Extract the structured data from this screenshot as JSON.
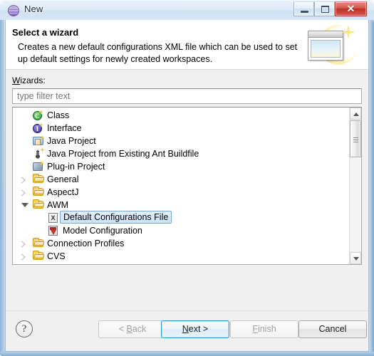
{
  "window": {
    "title": "New",
    "icon": "eclipse-sphere-icon",
    "controls": {
      "minimize": "minimize-icon",
      "maximize": "maximize-icon",
      "close": "✕"
    }
  },
  "banner": {
    "title": "Select a wizard",
    "description": "Creates a new default configurations XML file which can be used to set up default settings for newly created workspaces.",
    "art": "wizard-window-sparkle-graphic"
  },
  "form": {
    "wizards_label_prefix": "W",
    "wizards_label_rest": "izards:",
    "filter": {
      "placeholder": "type filter text",
      "value": ""
    }
  },
  "tree": {
    "rows": [
      {
        "label": "Class",
        "icon": "class-icon",
        "indent": 0,
        "twisty": "none",
        "selected": false
      },
      {
        "label": "Interface",
        "icon": "interface-icon",
        "indent": 0,
        "twisty": "none",
        "selected": false
      },
      {
        "label": "Java Project",
        "icon": "java-project-icon",
        "indent": 0,
        "twisty": "none",
        "selected": false
      },
      {
        "label": "Java Project from Existing Ant Buildfile",
        "icon": "ant-buildfile-icon",
        "indent": 0,
        "twisty": "none",
        "selected": false
      },
      {
        "label": "Plug-in Project",
        "icon": "plugin-project-icon",
        "indent": 0,
        "twisty": "none",
        "selected": false
      },
      {
        "label": "General",
        "icon": "folder-icon",
        "indent": 0,
        "twisty": "collapsed",
        "selected": false
      },
      {
        "label": "AspectJ",
        "icon": "folder-icon",
        "indent": 0,
        "twisty": "collapsed",
        "selected": false
      },
      {
        "label": "AWM",
        "icon": "folder-icon",
        "indent": 0,
        "twisty": "expanded",
        "selected": false
      },
      {
        "label": "Default Configurations File",
        "icon": "xml-file-icon",
        "indent": 1,
        "twisty": "none",
        "selected": true
      },
      {
        "label": "Model Configuration",
        "icon": "model-config-icon",
        "indent": 1,
        "twisty": "none",
        "selected": false
      },
      {
        "label": "Connection Profiles",
        "icon": "folder-icon",
        "indent": 0,
        "twisty": "collapsed",
        "selected": false
      },
      {
        "label": "CVS",
        "icon": "folder-icon",
        "indent": 0,
        "twisty": "collapsed",
        "selected": false
      }
    ],
    "scrollbar": {
      "up": "scroll-up-arrow-icon",
      "down": "scroll-down-arrow-icon"
    }
  },
  "buttons": {
    "help": "?",
    "back": {
      "prefix": "< ",
      "accel": "B",
      "rest": "ack",
      "state": "disabled"
    },
    "next": {
      "prefix": "",
      "accel": "N",
      "rest": "ext >",
      "state": "default"
    },
    "finish": {
      "prefix": "",
      "accel": "F",
      "rest": "inish",
      "state": "disabled"
    },
    "cancel": {
      "prefix": "",
      "accel": "",
      "rest": "Cancel",
      "state": "enabled"
    }
  },
  "colors": {
    "accent": "#2e92d4",
    "selection_fill": "#cfe4f8",
    "selection_border": "#7ba7d7",
    "close_button": "#b92f24",
    "folder": "#f7cf6a"
  }
}
